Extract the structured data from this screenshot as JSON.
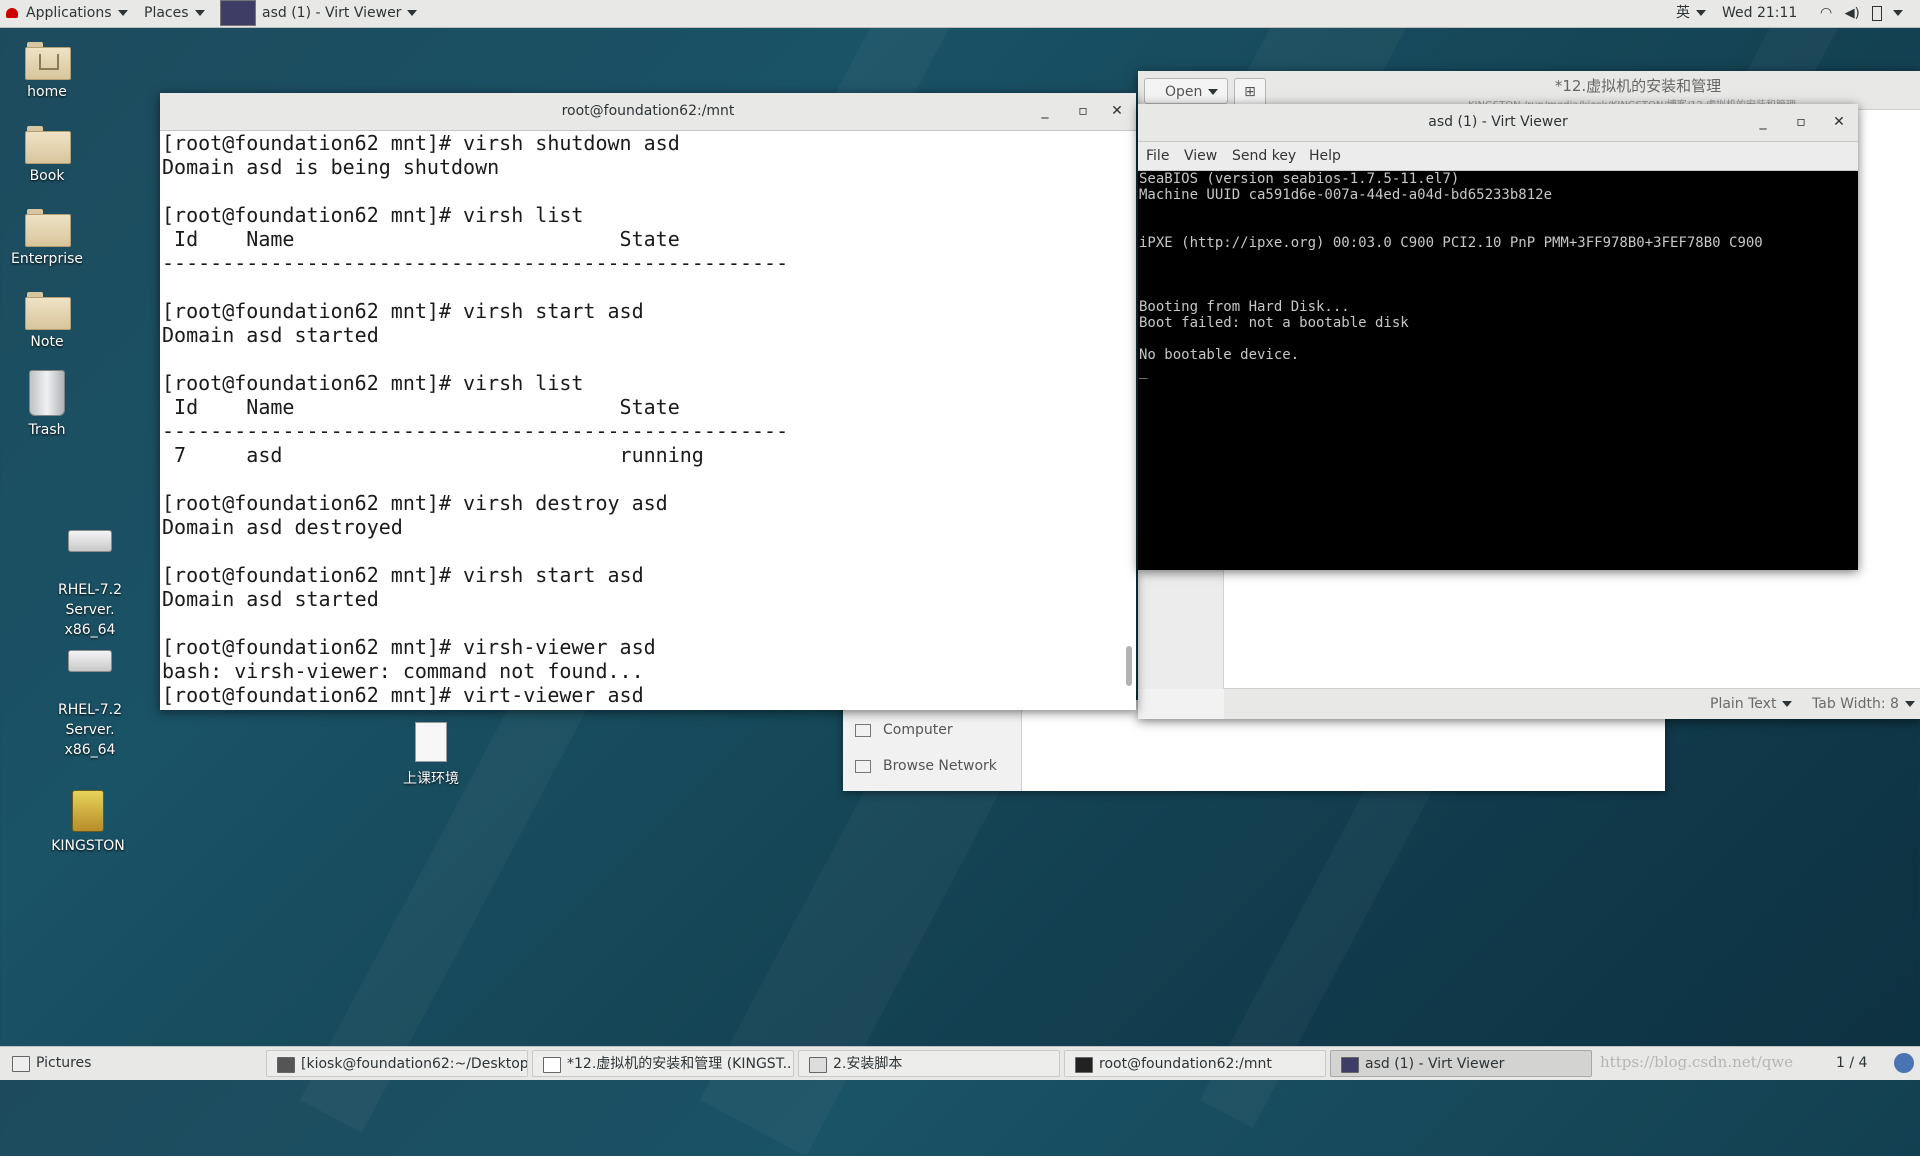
{
  "topbar": {
    "applications": "Applications",
    "places": "Places",
    "active_window": "asd (1) - Virt Viewer",
    "input_method": "英",
    "clock": "Wed 21:11"
  },
  "desktop": {
    "icons": [
      {
        "label": "home"
      },
      {
        "label": "Book"
      },
      {
        "label": "Enterprise"
      },
      {
        "label": "Note"
      },
      {
        "label": "Trash"
      },
      {
        "label": "RHEL-7.2 Server.\nx86_64"
      },
      {
        "label": "RHEL-7.2 Server.\nx86_64"
      },
      {
        "label": "上课环境"
      },
      {
        "label": "KINGSTON"
      }
    ]
  },
  "terminal": {
    "title": "root@foundation62:/mnt",
    "output": "[root@foundation62 mnt]# virsh shutdown asd\nDomain asd is being shutdown\n\n[root@foundation62 mnt]# virsh list\n Id    Name                           State\n----------------------------------------------------\n\n[root@foundation62 mnt]# virsh start asd\nDomain asd started\n\n[root@foundation62 mnt]# virsh list\n Id    Name                           State\n----------------------------------------------------\n 7     asd                            running\n\n[root@foundation62 mnt]# virsh destroy asd\nDomain asd destroyed\n\n[root@foundation62 mnt]# virsh start asd\nDomain asd started\n\n[root@foundation62 mnt]# virsh-viewer asd\nbash: virsh-viewer: command not found...\n[root@foundation62 mnt]# virt-viewer asd"
  },
  "gedit": {
    "open_label": "Open",
    "title": "*12.虚拟机的安装和管理",
    "subtitle": "KINGSTON /run/media/kiosk/KINGSTON/博客/12.虚拟机的安装和管理",
    "syntax": "Plain Text",
    "tab_width": "Tab Width: 8"
  },
  "files": {
    "items": [
      "Computer",
      "Browse Network"
    ]
  },
  "virt_viewer": {
    "title": "asd (1) - Virt Viewer",
    "menu": [
      "File",
      "View",
      "Send key",
      "Help"
    ],
    "console": "SeaBIOS (version seabios-1.7.5-11.el7)\nMachine UUID ca591d6e-007a-44ed-a04d-bd65233b812e\n\n\niPXE (http://ipxe.org) 00:03.0 C900 PCI2.10 PnP PMM+3FF978B0+3FEF78B0 C900\n\n\n\nBooting from Hard Disk...\nBoot failed: not a bootable disk\n\nNo bootable device.\n_"
  },
  "taskbar": {
    "tasks": [
      {
        "label": "Pictures"
      },
      {
        "label": "[kiosk@foundation62:~/Desktop]"
      },
      {
        "label": "*12.虚拟机的安装和管理 (KINGST..."
      },
      {
        "label": "2.安装脚本"
      },
      {
        "label": "root@foundation62:/mnt"
      },
      {
        "label": "asd (1) - Virt Viewer"
      }
    ],
    "watermark": "https://blog.csdn.net/qwe",
    "workspace": "1 / 4"
  }
}
